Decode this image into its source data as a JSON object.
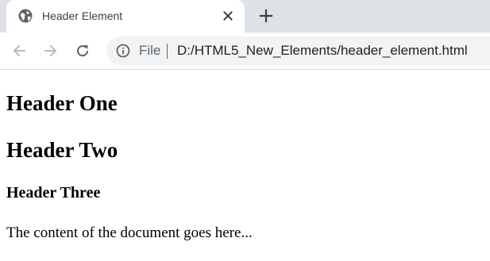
{
  "browser": {
    "tab": {
      "title": "Header Element",
      "favicon": "globe-icon",
      "close_icon": "close-icon"
    },
    "new_tab_icon": "plus-icon",
    "toolbar": {
      "back_icon": "arrow-left-icon",
      "forward_icon": "arrow-right-icon",
      "reload_icon": "reload-icon"
    },
    "address_bar": {
      "info_icon": "info-icon",
      "scheme_label": "File",
      "url": "D:/HTML5_New_Elements/header_element.html"
    },
    "colors": {
      "tabstrip_bg": "#dee1e6",
      "omnibox_bg": "#f1f3f4",
      "icon_color": "#5f6368"
    }
  },
  "page": {
    "header_one": "Header One",
    "header_two": "Header Two",
    "header_three": "Header Three",
    "paragraph": "The content of the document goes here..."
  }
}
